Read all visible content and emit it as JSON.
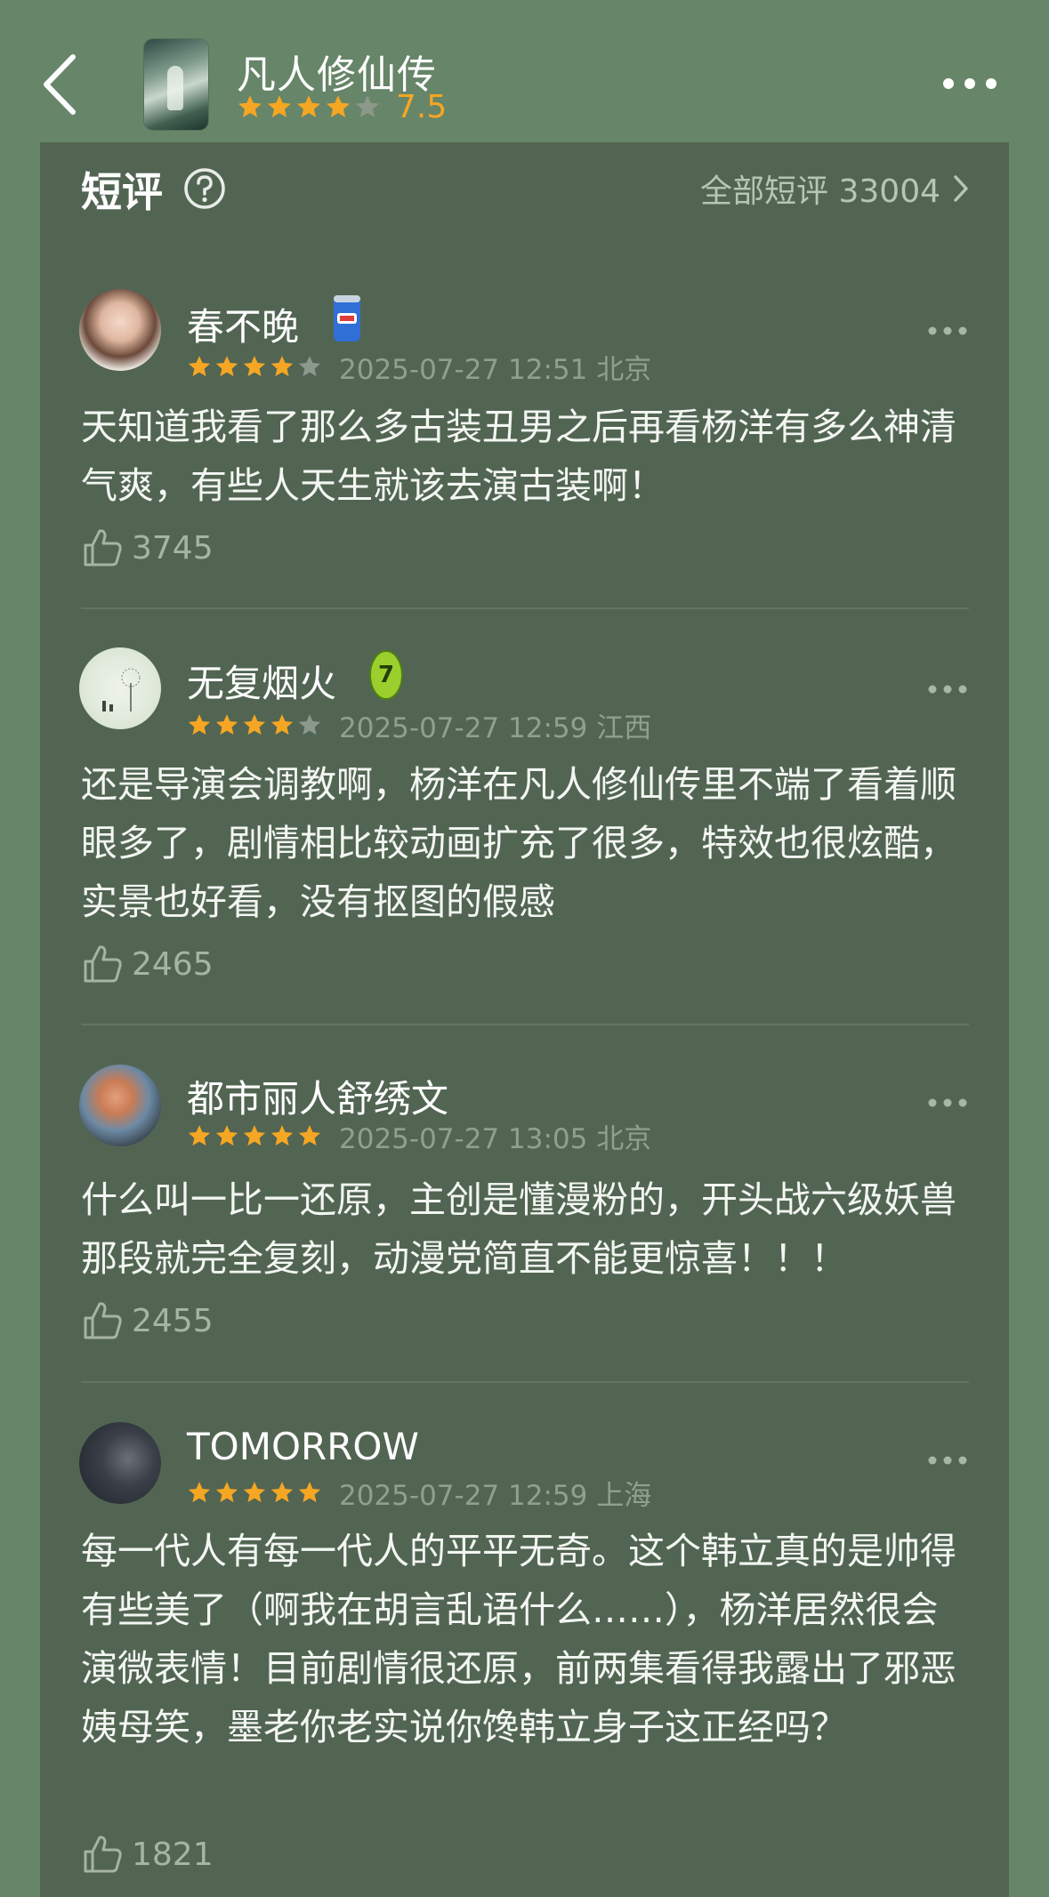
{
  "header": {
    "movie_title": "凡人修仙传",
    "rating_score": "7.5",
    "rating_stars": 4
  },
  "section": {
    "title": "短评",
    "all_reviews_label": "全部短评 33004"
  },
  "reviews": [
    {
      "username": "春不晚",
      "stars": 4,
      "meta": "2025-07-27 12:51 北京",
      "text": "天知道我看了那么多古装丑男之后再看杨洋有多么神清气爽，有些人天生就该去演古装啊！",
      "likes": "3745",
      "badge_icon": "can-badge-icon"
    },
    {
      "username": "无复烟火",
      "stars": 4,
      "meta": "2025-07-27 12:59 江西",
      "text": "还是导演会调教啊，杨洋在凡人修仙传里不端了看着顺眼多了，剧情相比较动画扩充了很多，特效也很炫酷，实景也好看，没有抠图的假感",
      "likes": "2465",
      "badge_icon": "number-7-badge-icon"
    },
    {
      "username": "都市丽人舒绣文",
      "stars": 5,
      "meta": "2025-07-27 13:05 北京",
      "text": "什么叫一比一还原，主创是懂漫粉的，开头战六级妖兽那段就完全复刻，动漫党简直不能更惊喜！！！",
      "likes": "2455"
    },
    {
      "username": "TOMORROW",
      "stars": 5,
      "meta": "2025-07-27 12:59 上海",
      "text": "每一代人有每一代人的平平无奇。这个韩立真的是帅得有些美了（啊我在胡言乱语什么……），杨洋居然很会演微表情！目前剧情很还原，前两集看得我露出了邪恶姨母笑，墨老你老实说你馋韩立身子这正经吗？",
      "likes": "1821"
    }
  ],
  "colors": {
    "star_filled": "#f5a623",
    "star_empty": "#8b988b",
    "panel": "#526553",
    "background": "#678568"
  }
}
